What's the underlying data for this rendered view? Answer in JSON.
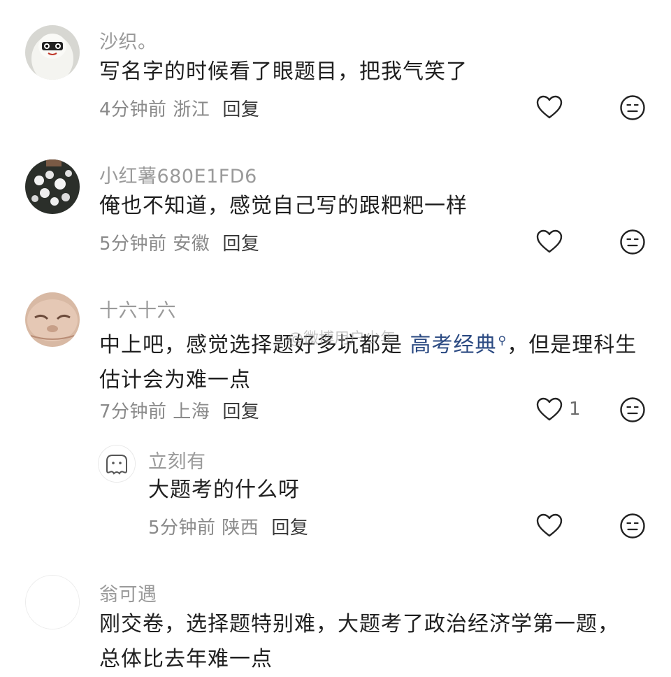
{
  "comments": [
    {
      "name": "沙织。",
      "text": "写名字的时候看了眼题目，把我气笑了",
      "time_location": "4分钟前 浙江",
      "reply_label": "回复",
      "like_count": ""
    },
    {
      "name": "小红薯680E1FD6",
      "text": "俺也不知道，感觉自己写的跟粑粑一样",
      "time_location": "5分钟前 安徽",
      "reply_label": "回复",
      "like_count": ""
    },
    {
      "name": "十六十六",
      "text_before": "中上吧，感觉选择题好多坑都是 ",
      "link_text": "高考经典",
      "text_after": "，但是理科生估计会为难一点",
      "time_location": "7分钟前 上海",
      "reply_label": "回复",
      "like_count": "1"
    },
    {
      "name": "立刻有",
      "text": "大题考的什么呀",
      "time_location": "5分钟前 陕西",
      "reply_label": "回复",
      "like_count": ""
    },
    {
      "name": "翁可遇",
      "text": "刚交卷，选择题特别难，大题考了政治经济学第一题，总体比去年难一点"
    }
  ],
  "watermark": "@微博用户少年",
  "icons": {
    "like": "heart-outline-icon",
    "dislike": "meh-face-icon",
    "link_search": "search-icon"
  }
}
